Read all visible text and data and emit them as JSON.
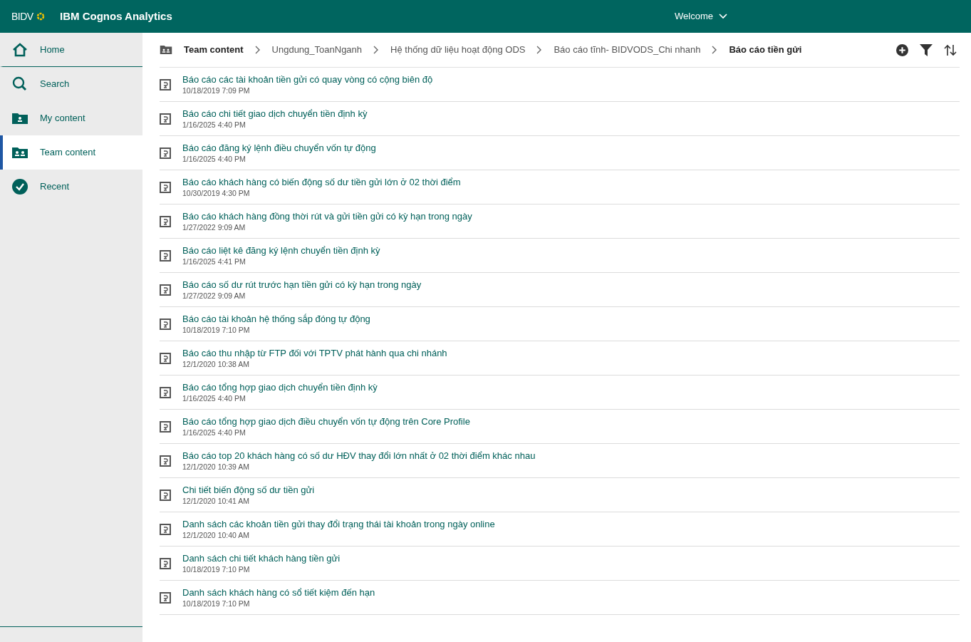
{
  "header": {
    "brand": "BIDV",
    "title": "IBM Cognos Analytics",
    "welcome": "Welcome"
  },
  "sidebar": {
    "items": [
      {
        "kind": "home",
        "label": "Home",
        "selected": false
      },
      {
        "kind": "search",
        "label": "Search",
        "selected": false
      },
      {
        "kind": "my",
        "label": "My content",
        "selected": false
      },
      {
        "kind": "team",
        "label": "Team content",
        "selected": true
      },
      {
        "kind": "recent",
        "label": "Recent",
        "selected": false
      }
    ]
  },
  "breadcrumb": [
    {
      "label": "Team content",
      "current": true
    },
    {
      "label": "Ungdung_ToanNganh",
      "current": false
    },
    {
      "label": "Hệ thống dữ liệu hoạt động ODS",
      "current": false
    },
    {
      "label": "Báo cáo tĩnh- BIDVODS_Chi nhanh",
      "current": false
    },
    {
      "label": "Báo cáo tiền gửi",
      "current": true
    }
  ],
  "items": [
    {
      "name": "Báo cáo các tài khoản tiền gửi có quay vòng có cộng biên độ",
      "date": "10/18/2019 7:09 PM"
    },
    {
      "name": "Báo cáo chi tiết giao dịch chuyển tiền định kỳ",
      "date": "1/16/2025 4:40 PM"
    },
    {
      "name": "Báo cáo đăng ký lệnh điều chuyển vốn tự động",
      "date": "1/16/2025 4:40 PM"
    },
    {
      "name": "Báo cáo khách hàng có biến động số dư tiền gửi lớn ở 02 thời điểm",
      "date": "10/30/2019 4:30 PM"
    },
    {
      "name": "Báo cáo khách hàng đồng thời rút và gửi tiền gửi có kỳ hạn trong ngày",
      "date": "1/27/2022 9:09 AM"
    },
    {
      "name": "Báo cáo liệt kê đăng ký lệnh chuyển tiền định kỳ",
      "date": "1/16/2025 4:41 PM"
    },
    {
      "name": "Báo cáo số dư rút trước hạn tiền gửi có kỳ hạn trong ngày",
      "date": "1/27/2022 9:09 AM"
    },
    {
      "name": "Báo cáo tài khoản hệ thống sắp đóng tự động",
      "date": "10/18/2019 7:10 PM"
    },
    {
      "name": "Báo cáo thu nhập từ FTP đối với TPTV phát hành qua chi nhánh",
      "date": "12/1/2020 10:38 AM"
    },
    {
      "name": "Báo cáo tổng hợp giao dịch chuyển tiền định kỳ",
      "date": "1/16/2025 4:40 PM"
    },
    {
      "name": "Báo cáo tổng hợp giao dịch điều chuyển vốn tự động trên Core Profile",
      "date": "1/16/2025 4:40 PM"
    },
    {
      "name": "Báo cáo top 20 khách hàng có số dư HĐV thay đổi lớn nhất ở 02 thời điểm khác nhau",
      "date": "12/1/2020 10:39 AM"
    },
    {
      "name": "Chi tiết biến động số dư tiền gửi",
      "date": "12/1/2020 10:41 AM"
    },
    {
      "name": "Danh sách các khoản tiền gửi thay đổi trạng thái tài khoản trong ngày online",
      "date": "12/1/2020 10:40 AM"
    },
    {
      "name": "Danh sách chi tiết khách hàng tiền gửi",
      "date": "10/18/2019 7:10 PM"
    },
    {
      "name": "Danh sách khách hàng có sổ tiết kiệm đến hạn",
      "date": "10/18/2019 7:10 PM"
    }
  ]
}
